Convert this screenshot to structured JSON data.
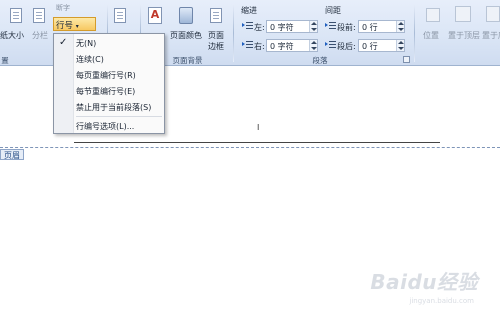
{
  "ribbon": {
    "left_partial": [
      "纸大小",
      "分栏"
    ],
    "hyphen_label": "断字",
    "line_number_button": "行号",
    "mid_buttons": [
      "页面颜色",
      "页面边框"
    ],
    "page_bg_group": "页面背景",
    "indent_title": "缩进",
    "spacing_title": "间距",
    "indent_left_label": "左:",
    "indent_left_value": "0 字符",
    "indent_right_label": "右:",
    "indent_right_value": "0 字符",
    "spacing_before_label": "段前:",
    "spacing_before_value": "0 行",
    "spacing_after_label": "段后:",
    "spacing_after_value": "0 行",
    "paragraph_group": "段落",
    "right_buttons": [
      "位置",
      "置于顶层",
      "置于底层"
    ],
    "left_group_partial": "置"
  },
  "menu": {
    "items": [
      {
        "label": "无(N)",
        "checked": true
      },
      {
        "label": "连续(C)",
        "checked": false
      },
      {
        "label": "每页重编行号(R)",
        "checked": false
      },
      {
        "label": "每节重编行号(E)",
        "checked": false
      },
      {
        "label": "禁止用于当前段落(S)",
        "checked": false
      },
      {
        "label": "行编号选项(L)...",
        "checked": false
      }
    ]
  },
  "document": {
    "header_tag": "页眉",
    "cursor_mark": "I",
    "watermark": "Baidu经验",
    "watermark_sub": "jingyan.baidu.com"
  }
}
